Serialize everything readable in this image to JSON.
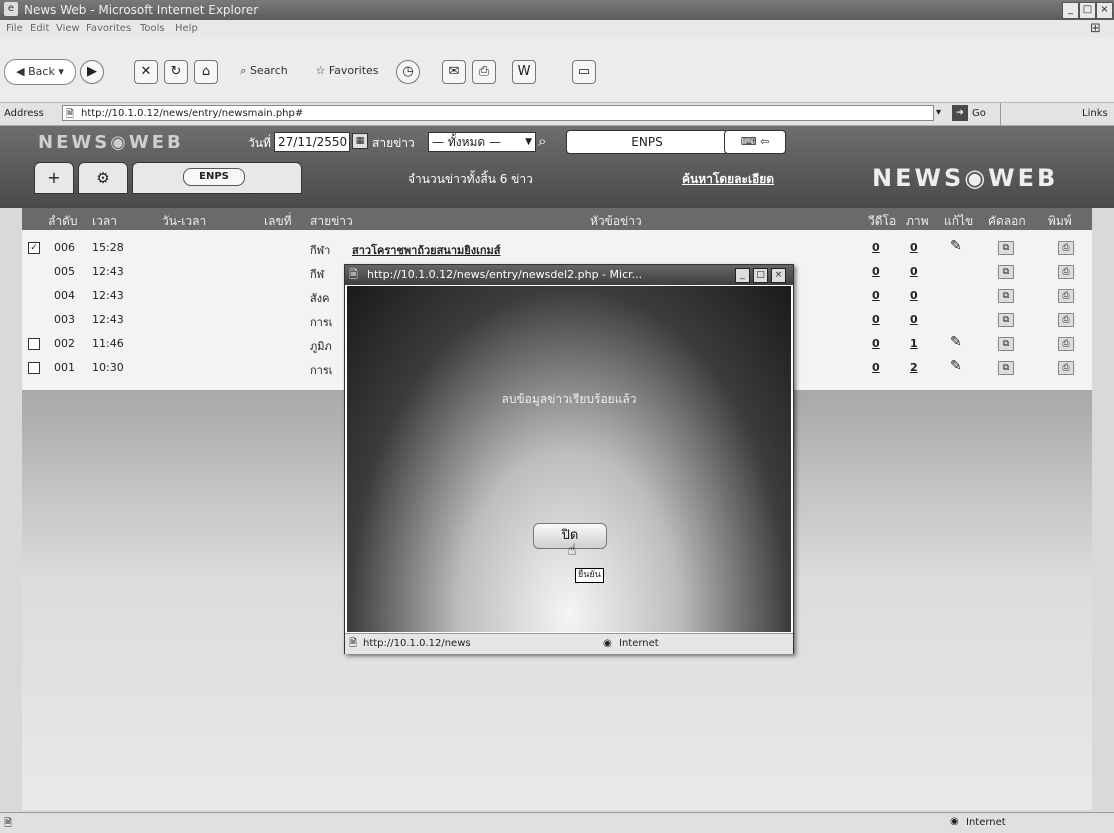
{
  "window": {
    "title": "News Web - Microsoft Internet Explorer"
  },
  "menu": [
    "File",
    "Edit",
    "View",
    "Favorites",
    "Tools",
    "Help"
  ],
  "toolbar": {
    "back": "Back",
    "search": "Search",
    "favorites": "Favorites"
  },
  "address": {
    "label": "Address",
    "url": "http://10.1.0.12/news/entry/newsmain.php#",
    "go": "Go",
    "links": "Links"
  },
  "app": {
    "logo": "NEWS◉WEB",
    "date_label": "วันที่",
    "date_value": "27/11/2550",
    "category_label": "สายข่าว",
    "category_value": "— ทั้งหมด —",
    "enps": "ENPS",
    "tab_enps": "ENPS",
    "count_text": "จำนวนข่าวทั้งสิ้น 6 ข่าว",
    "advanced_search": "ค้นหาโดยละเอียด",
    "banner": "NEWS◉WEB"
  },
  "columns": [
    "ลำดับ",
    "เวลา",
    "วัน-เวลา",
    "เลขที่",
    "สายข่าว",
    "หัวข้อข่าว",
    "วีดีโอ",
    "ภาพ",
    "แก้ไข",
    "คัดลอก",
    "พิมพ์"
  ],
  "rows": [
    {
      "checked": true,
      "seq": "006",
      "time": "15:28",
      "category": "กีฬา",
      "headline": "สาวโคราชพาถ้วยสนามยิงเกมส์",
      "video": "0",
      "image": "0",
      "editable": true
    },
    {
      "checked": false,
      "seq": "005",
      "time": "12:43",
      "category": "กีฬ",
      "headline": "",
      "video": "0",
      "image": "0",
      "editable": false
    },
    {
      "checked": false,
      "seq": "004",
      "time": "12:43",
      "category": "สังค",
      "headline": "",
      "video": "0",
      "image": "0",
      "editable": false
    },
    {
      "checked": false,
      "seq": "003",
      "time": "12:43",
      "category": "การเ",
      "headline": "",
      "video": "0",
      "image": "0",
      "editable": false
    },
    {
      "checked": false,
      "seq": "002",
      "time": "11:46",
      "category": "ภูมิภ",
      "headline": "",
      "video": "0",
      "image": "1",
      "editable": true
    },
    {
      "checked": false,
      "seq": "001",
      "time": "10:30",
      "category": "การเ",
      "headline": "",
      "video": "0",
      "image": "2",
      "editable": true
    }
  ],
  "popup": {
    "title": "http://10.1.0.12/news/entry/newsdel2.php - Micr...",
    "message": "ลบข้อมูลข่าวเรียบร้อยแล้ว",
    "close_button": "ปิด",
    "tooltip": "ยืนยัน",
    "status_url": "http://10.1.0.12/news",
    "status_zone": "Internet"
  },
  "status": {
    "zone": "Internet"
  }
}
